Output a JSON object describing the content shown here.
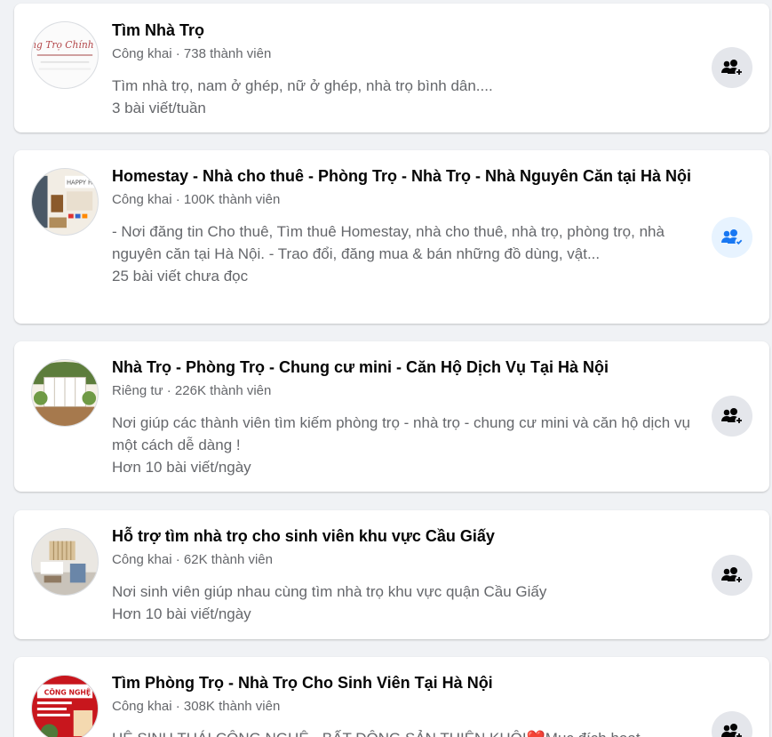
{
  "groups": [
    {
      "title": "Tìm Nhà Trọ",
      "privacy": "Công khai",
      "members": "738 thành viên",
      "description": "Tìm nhà trọ, nam ở ghép, nữ ở ghép, nhà trọ bình dân....",
      "activity": "3 bài viết/tuần",
      "joined": false
    },
    {
      "title": "Homestay - Nhà cho thuê - Phòng Trọ - Nhà Trọ - Nhà Nguyên Căn tại Hà Nội",
      "privacy": "Công khai",
      "members": "100K thành viên",
      "description": "- Nơi đăng tin Cho thuê, Tìm thuê Homestay, nhà cho thuê, nhà trọ, phòng trọ, nhà nguyên căn tại Hà Nội. - Trao đổi, đăng mua & bán những đồ dùng, vật...",
      "activity": "25 bài viết chưa đọc",
      "joined": true
    },
    {
      "title": "Nhà Trọ - Phòng Trọ - Chung cư mini - Căn Hộ Dịch Vụ Tại Hà Nội",
      "privacy": "Riêng tư",
      "members": "226K thành viên",
      "description": "Nơi giúp các thành viên tìm kiếm phòng trọ - nhà trọ - chung cư mini và căn hộ dịch vụ một cách dễ dàng !",
      "activity": "Hơn 10 bài viết/ngày",
      "joined": false
    },
    {
      "title": "Hỗ trợ tìm nhà trọ cho sinh viên khu vực Cầu Giấy",
      "privacy": "Công khai",
      "members": "62K thành viên",
      "description": "Nơi sinh viên giúp nhau cùng tìm nhà trọ khu vực quận Cầu Giấy",
      "activity": "Hơn 10 bài viết/ngày",
      "joined": false
    },
    {
      "title": "Tìm Phòng Trọ - Nhà Trọ Cho Sinh Viên Tại Hà Nội",
      "privacy": "Công khai",
      "members": "308K thành viên",
      "description": "HỆ SINH THÁI CÔNG NGHỆ - BẤT ĐỘNG SẢN THIÊN KHÔI❤️Mục đích hoạt",
      "activity": "",
      "joined": false
    }
  ],
  "meta_separator": " · ",
  "colors": {
    "background": "#f0f2f5",
    "card": "#ffffff",
    "primary_text": "#050505",
    "secondary_text": "#65676b",
    "join_button": "#e4e6eb",
    "joined_button": "#e7f3ff",
    "joined_icon": "#1877f2"
  },
  "avatar_1_text": "ng Trọ Chính Chủ",
  "avatar_2_text": "HAPPY HO",
  "avatar_5_text": "CÔNG NGHỆ"
}
